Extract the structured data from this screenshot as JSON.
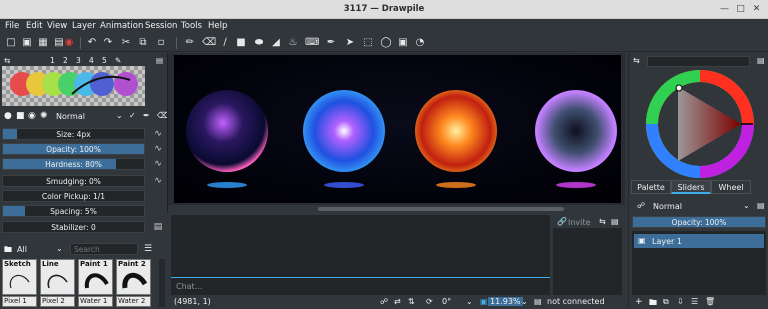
{
  "window": {
    "title": "3117 — Drawpile"
  },
  "menubar": [
    "File",
    "Edit",
    "View",
    "Layer",
    "Animation",
    "Session",
    "Tools",
    "Help"
  ],
  "toolbar_icons": [
    "new-icon",
    "open-icon",
    "save-icon",
    "record-icon",
    "undo-icon",
    "redo-icon",
    "cut-icon",
    "copy-icon",
    "paste-icon",
    "freehand-icon",
    "eraser-icon",
    "line-icon",
    "rectangle-icon",
    "ellipse-icon",
    "fill-icon",
    "text-icon",
    "color-picker-icon",
    "select-icon",
    "rect-select-icon",
    "lasso-icon",
    "transform-icon",
    "zoom-icon",
    "inspector-icon"
  ],
  "brush_panel": {
    "slots": [
      "1",
      "2",
      "3",
      "4",
      "5"
    ],
    "palette_colors": [
      "#e84b4b",
      "#e8c83a",
      "#a8e04a",
      "#4ad06a",
      "#4ab8e8",
      "#5060d0",
      "#b050d0"
    ],
    "blend_mode": "Normal",
    "sliders": [
      {
        "label": "Size: 4px",
        "value": 0.1
      },
      {
        "label": "Opacity: 100%",
        "value": 1.0
      },
      {
        "label": "Hardness: 80%",
        "value": 0.8
      },
      {
        "label": "Smudging: 0%",
        "value": 0.0
      },
      {
        "label": "Color Pickup: 1/1",
        "value": 0.0
      },
      {
        "label": "Spacing: 5%",
        "value": 0.15
      },
      {
        "label": "Stabilizer: 0",
        "value": 0.0
      }
    ]
  },
  "brush_presets": {
    "filter": "All",
    "search_placeholder": "Search",
    "tiles": [
      "Sketch",
      "Line",
      "Paint 1",
      "Paint 2"
    ],
    "tiles_row2": [
      "Pixel 1",
      "Pixel 2",
      "Water 1",
      "Water 2"
    ]
  },
  "chat": {
    "placeholder": "Chat...",
    "invite_label": "Invite"
  },
  "statusbar": {
    "coords": "(4981, 1)",
    "rotation": "0°",
    "zoom": "11.93%",
    "connection": "not connected"
  },
  "right_panel": {
    "tabs": [
      "Palette",
      "Sliders",
      "Wheel"
    ],
    "active_tab": "Sliders",
    "layer_blend": "Normal",
    "layer_opacity": "Opacity: 100%",
    "layers": [
      "Layer 1"
    ]
  }
}
